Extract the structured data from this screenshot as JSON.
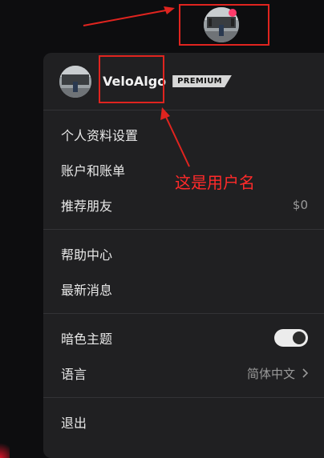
{
  "header": {
    "username": "VeloAlgo",
    "badge": "PREMIUM"
  },
  "menu": {
    "section1": [
      {
        "label": "个人资料设置"
      },
      {
        "label": "账户和账单"
      },
      {
        "label": "推荐朋友",
        "value": "$0"
      }
    ],
    "section2": [
      {
        "label": "帮助中心"
      },
      {
        "label": "最新消息"
      }
    ],
    "section3": {
      "theme_label": "暗色主题",
      "theme_on": true,
      "language_label": "语言",
      "language_value": "简体中文"
    },
    "logout_label": "退出"
  },
  "annotation": {
    "text": "这是用户名",
    "color": "#e0241f"
  },
  "colors": {
    "menu_bg": "#202022",
    "notify_dot": "#ff3b6b"
  }
}
